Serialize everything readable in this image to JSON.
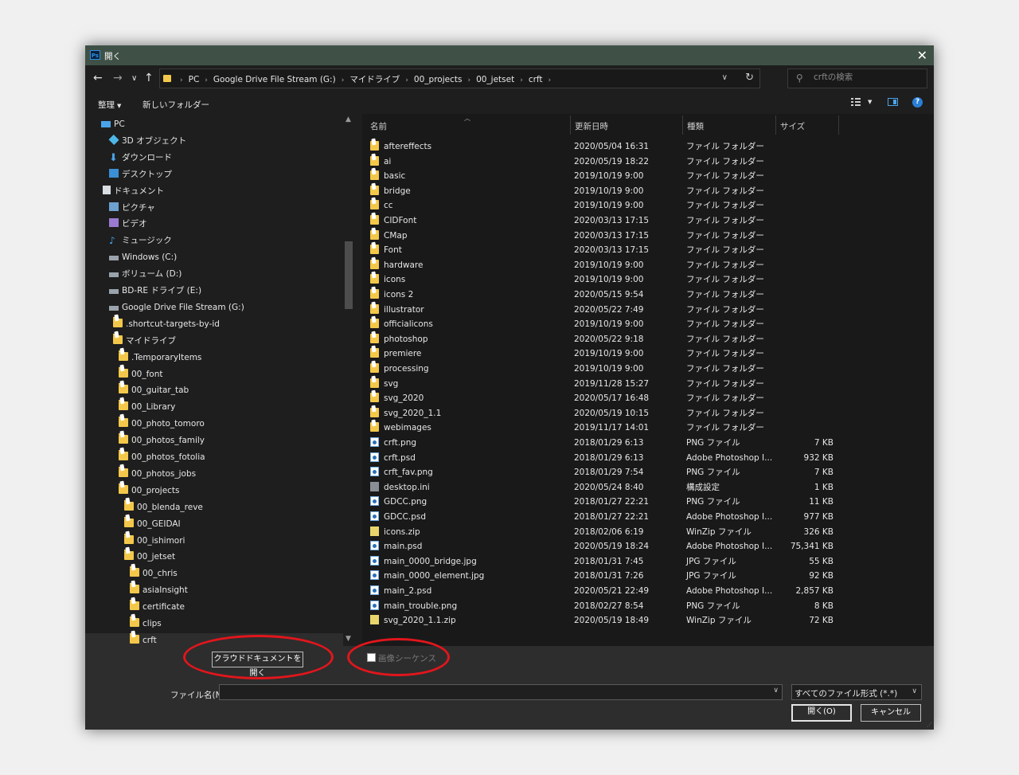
{
  "window": {
    "title": "開く",
    "app_icon": "Ps"
  },
  "nav": {
    "breadcrumbs": [
      "PC",
      "Google Drive File Stream (G:)",
      "マイドライブ",
      "00_projects",
      "00_jetset",
      "crft"
    ],
    "search_placeholder": "crftの検索"
  },
  "toolbar": {
    "organize": "整理",
    "new_folder": "新しいフォルダー"
  },
  "tree": {
    "items": [
      {
        "label": "PC",
        "icon": "pc-icon"
      },
      {
        "label": "3D オブジェクト",
        "icon": "cube-icon"
      },
      {
        "label": "ダウンロード",
        "icon": "download-icon"
      },
      {
        "label": "デスクトップ",
        "icon": "desktop-icon"
      },
      {
        "label": "ドキュメント",
        "icon": "document-icon"
      },
      {
        "label": "ピクチャ",
        "icon": "pictures-icon"
      },
      {
        "label": "ビデオ",
        "icon": "video-icon"
      },
      {
        "label": "ミュージック",
        "icon": "music-icon"
      },
      {
        "label": "Windows (C:)",
        "icon": "drive-icon"
      },
      {
        "label": "ボリューム (D:)",
        "icon": "drive-icon"
      },
      {
        "label": "BD-RE ドライブ (E:)",
        "icon": "disc-drive-icon"
      },
      {
        "label": "Google Drive File Stream (G:)",
        "icon": "drive-icon"
      },
      {
        "label": ".shortcut-targets-by-id",
        "icon": "folder-icon"
      },
      {
        "label": "マイドライブ",
        "icon": "folder-icon"
      },
      {
        "label": ".TemporaryItems",
        "icon": "folder-icon"
      },
      {
        "label": "00_font",
        "icon": "folder-icon"
      },
      {
        "label": "00_guitar_tab",
        "icon": "folder-icon"
      },
      {
        "label": "00_Library",
        "icon": "folder-icon"
      },
      {
        "label": "00_photo_tomoro",
        "icon": "folder-icon"
      },
      {
        "label": "00_photos_family",
        "icon": "folder-icon"
      },
      {
        "label": "00_photos_fotolia",
        "icon": "folder-icon"
      },
      {
        "label": "00_photos_jobs",
        "icon": "folder-icon"
      },
      {
        "label": "00_projects",
        "icon": "folder-icon"
      },
      {
        "label": "00_blenda_reve",
        "icon": "folder-icon"
      },
      {
        "label": "00_GEIDAI",
        "icon": "folder-icon"
      },
      {
        "label": "00_ishimori",
        "icon": "folder-icon"
      },
      {
        "label": "00_jetset",
        "icon": "folder-icon"
      },
      {
        "label": "00_chris",
        "icon": "folder-icon"
      },
      {
        "label": "asiaInsight",
        "icon": "folder-icon"
      },
      {
        "label": "certificate",
        "icon": "folder-icon"
      },
      {
        "label": "clips",
        "icon": "folder-icon"
      },
      {
        "label": "crft",
        "icon": "folder-icon"
      }
    ]
  },
  "list": {
    "columns": [
      "名前",
      "更新日時",
      "種類",
      "サイズ"
    ],
    "rows": [
      {
        "name": "aftereffects",
        "date": "2020/05/04 16:31",
        "type": "ファイル フォルダー",
        "size": "",
        "icon": "folder-icon"
      },
      {
        "name": "ai",
        "date": "2020/05/19 18:22",
        "type": "ファイル フォルダー",
        "size": "",
        "icon": "folder-icon"
      },
      {
        "name": "basic",
        "date": "2019/10/19 9:00",
        "type": "ファイル フォルダー",
        "size": "",
        "icon": "folder-icon"
      },
      {
        "name": "bridge",
        "date": "2019/10/19 9:00",
        "type": "ファイル フォルダー",
        "size": "",
        "icon": "folder-icon"
      },
      {
        "name": "cc",
        "date": "2019/10/19 9:00",
        "type": "ファイル フォルダー",
        "size": "",
        "icon": "folder-icon"
      },
      {
        "name": "CIDFont",
        "date": "2020/03/13 17:15",
        "type": "ファイル フォルダー",
        "size": "",
        "icon": "folder-icon"
      },
      {
        "name": "CMap",
        "date": "2020/03/13 17:15",
        "type": "ファイル フォルダー",
        "size": "",
        "icon": "folder-icon"
      },
      {
        "name": "Font",
        "date": "2020/03/13 17:15",
        "type": "ファイル フォルダー",
        "size": "",
        "icon": "folder-icon"
      },
      {
        "name": "hardware",
        "date": "2019/10/19 9:00",
        "type": "ファイル フォルダー",
        "size": "",
        "icon": "folder-icon"
      },
      {
        "name": "icons",
        "date": "2019/10/19 9:00",
        "type": "ファイル フォルダー",
        "size": "",
        "icon": "folder-icon"
      },
      {
        "name": "icons 2",
        "date": "2020/05/15 9:54",
        "type": "ファイル フォルダー",
        "size": "",
        "icon": "folder-icon"
      },
      {
        "name": "illustrator",
        "date": "2020/05/22 7:49",
        "type": "ファイル フォルダー",
        "size": "",
        "icon": "folder-icon"
      },
      {
        "name": "officialicons",
        "date": "2019/10/19 9:00",
        "type": "ファイル フォルダー",
        "size": "",
        "icon": "folder-icon"
      },
      {
        "name": "photoshop",
        "date": "2020/05/22 9:18",
        "type": "ファイル フォルダー",
        "size": "",
        "icon": "folder-icon"
      },
      {
        "name": "premiere",
        "date": "2019/10/19 9:00",
        "type": "ファイル フォルダー",
        "size": "",
        "icon": "folder-icon"
      },
      {
        "name": "processing",
        "date": "2019/10/19 9:00",
        "type": "ファイル フォルダー",
        "size": "",
        "icon": "folder-icon"
      },
      {
        "name": "svg",
        "date": "2019/11/28 15:27",
        "type": "ファイル フォルダー",
        "size": "",
        "icon": "folder-icon"
      },
      {
        "name": "svg_2020",
        "date": "2020/05/17 16:48",
        "type": "ファイル フォルダー",
        "size": "",
        "icon": "folder-icon"
      },
      {
        "name": "svg_2020_1.1",
        "date": "2020/05/19 10:15",
        "type": "ファイル フォルダー",
        "size": "",
        "icon": "folder-icon"
      },
      {
        "name": "webimages",
        "date": "2019/11/17 14:01",
        "type": "ファイル フォルダー",
        "size": "",
        "icon": "folder-icon"
      },
      {
        "name": "crft.png",
        "date": "2018/01/29 6:13",
        "type": "PNG ファイル",
        "size": "7 KB",
        "icon": "image-file-icon"
      },
      {
        "name": "crft.psd",
        "date": "2018/01/29 6:13",
        "type": "Adobe Photoshop I...",
        "size": "932 KB",
        "icon": "image-file-icon"
      },
      {
        "name": "crft_fav.png",
        "date": "2018/01/29 7:54",
        "type": "PNG ファイル",
        "size": "7 KB",
        "icon": "image-file-icon"
      },
      {
        "name": "desktop.ini",
        "date": "2020/05/24 8:40",
        "type": "構成設定",
        "size": "1 KB",
        "icon": "settings-file-icon"
      },
      {
        "name": "GDCC.png",
        "date": "2018/01/27 22:21",
        "type": "PNG ファイル",
        "size": "11 KB",
        "icon": "image-file-icon"
      },
      {
        "name": "GDCC.psd",
        "date": "2018/01/27 22:21",
        "type": "Adobe Photoshop I...",
        "size": "977 KB",
        "icon": "image-file-icon"
      },
      {
        "name": "icons.zip",
        "date": "2018/02/06 6:19",
        "type": "WinZip ファイル",
        "size": "326 KB",
        "icon": "zip-file-icon"
      },
      {
        "name": "main.psd",
        "date": "2020/05/19 18:24",
        "type": "Adobe Photoshop I...",
        "size": "75,341 KB",
        "icon": "image-file-icon"
      },
      {
        "name": "main_0000_bridge.jpg",
        "date": "2018/01/31 7:45",
        "type": "JPG ファイル",
        "size": "55 KB",
        "icon": "image-file-icon"
      },
      {
        "name": "main_0000_element.jpg",
        "date": "2018/01/31 7:26",
        "type": "JPG ファイル",
        "size": "92 KB",
        "icon": "image-file-icon"
      },
      {
        "name": "main_2.psd",
        "date": "2020/05/21 22:49",
        "type": "Adobe Photoshop I...",
        "size": "2,857 KB",
        "icon": "image-file-icon"
      },
      {
        "name": "main_trouble.png",
        "date": "2018/02/27 8:54",
        "type": "PNG ファイル",
        "size": "8 KB",
        "icon": "image-file-icon"
      },
      {
        "name": "svg_2020_1.1.zip",
        "date": "2020/05/19 18:49",
        "type": "WinZip ファイル",
        "size": "72 KB",
        "icon": "zip-file-icon"
      }
    ]
  },
  "bottom": {
    "cloud_button": "クラウドドキュメントを開く",
    "image_sequence_label": "画像シーケンス",
    "filename_label": "ファイル名(N):",
    "filename_value": "",
    "filetype_value": "すべてのファイル形式 (*.*)",
    "open_button": "開く(O)",
    "cancel_button": "キャンセル"
  },
  "colors": {
    "highlight_ring": "#e1161c",
    "titlebar": "#3f5147",
    "folder": "#f3c84a"
  }
}
